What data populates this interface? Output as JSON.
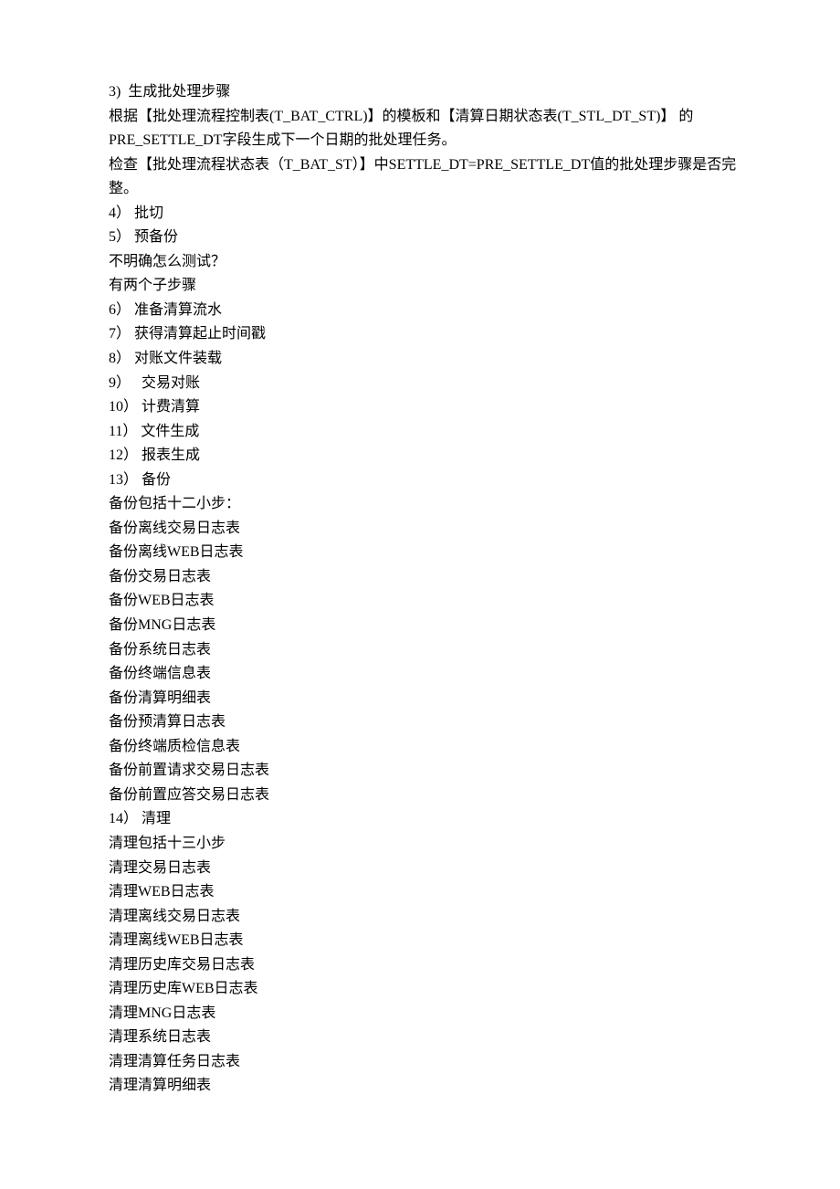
{
  "lines": [
    "3)  生成批处理步骤",
    "根据【批处理流程控制表(T_BAT_CTRL)】的模板和【清算日期状态表(T_STL_DT_ST)】 的PRE_SETTLE_DT字段生成下一个日期的批处理任务。",
    "检查【批处理流程状态表（T_BAT_ST）】中SETTLE_DT=PRE_SETTLE_DT值的批处理步骤是否完整。",
    "4） 批切",
    "5） 预备份",
    "不明确怎么测试？",
    "有两个子步骤",
    "6） 准备清算流水",
    "7） 获得清算起止时间戳",
    "8） 对账文件装载",
    "9）   交易对账",
    "10） 计费清算",
    "11） 文件生成",
    "12） 报表生成",
    "13） 备份",
    "备份包括十二小步：",
    "备份离线交易日志表",
    "备份离线WEB日志表",
    "备份交易日志表",
    "备份WEB日志表",
    "备份MNG日志表",
    "备份系统日志表",
    "备份终端信息表",
    "备份清算明细表",
    "备份预清算日志表",
    "备份终端质检信息表",
    "备份前置请求交易日志表",
    "备份前置应答交易日志表",
    "14） 清理",
    "清理包括十三小步",
    "清理交易日志表",
    "清理WEB日志表",
    "清理离线交易日志表",
    "清理离线WEB日志表",
    "清理历史库交易日志表",
    "清理历史库WEB日志表",
    "清理MNG日志表",
    "清理系统日志表",
    "清理清算任务日志表",
    "清理清算明细表"
  ]
}
